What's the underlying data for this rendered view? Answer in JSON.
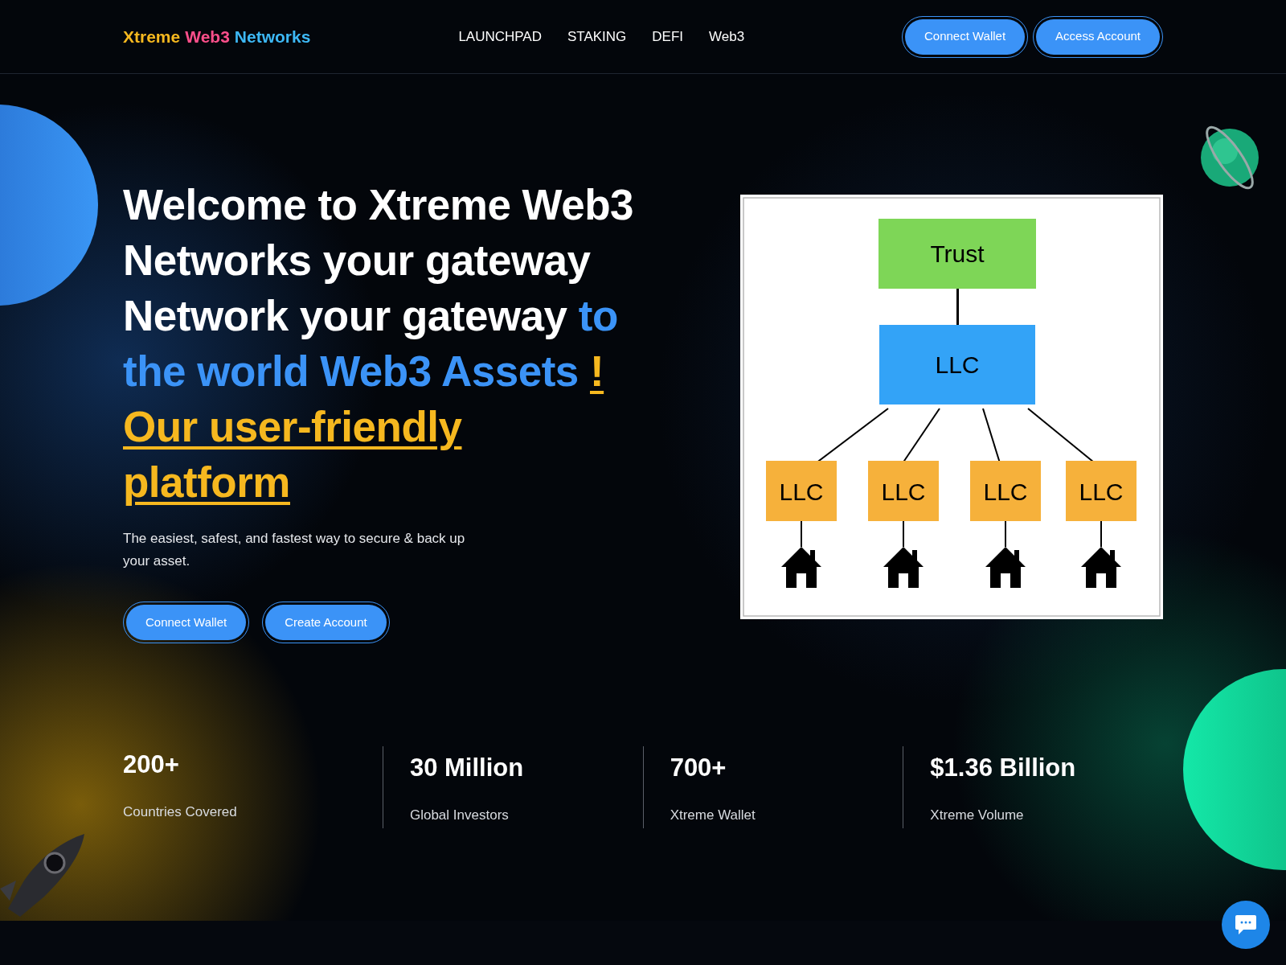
{
  "header": {
    "logo": [
      {
        "text": "Xtreme",
        "color": "#f6b81f"
      },
      {
        "text": "Web3",
        "color": "#ff4f8b"
      },
      {
        "text": "Networks",
        "color": "#3db8f5"
      }
    ],
    "nav": [
      "LAUNCHPAD",
      "STAKING",
      "DEFI",
      "Web3"
    ],
    "buttons": [
      "Connect Wallet",
      "Access Account"
    ]
  },
  "hero": {
    "heading": [
      {
        "text": "Welcome to Xtreme Web3 Networks your gateway Network your gateway ",
        "kind": "plain"
      },
      {
        "text": "to the world Web3 Assets ",
        "kind": "accent"
      },
      {
        "text": "! Our user-friendly platform",
        "kind": "underlined"
      }
    ],
    "subtitle": "The easiest, safest, and fastest way to secure & back up your asset.",
    "buttons": [
      "Connect Wallet",
      "Create Account"
    ],
    "diagram": {
      "root": {
        "label": "Trust",
        "color": "#7ed657"
      },
      "middle": {
        "label": "LLC",
        "color": "#33a3f7"
      },
      "children": [
        {
          "label": "LLC",
          "color": "#f6b13b"
        },
        {
          "label": "LLC",
          "color": "#f6b13b"
        },
        {
          "label": "LLC",
          "color": "#f6b13b"
        },
        {
          "label": "LLC",
          "color": "#f6b13b"
        }
      ]
    }
  },
  "stats": [
    {
      "value": "200+",
      "label": "Countries Covered"
    },
    {
      "value": "30 Million",
      "label": "Global Investors"
    },
    {
      "value": "700+",
      "label": "Xtreme Wallet"
    },
    {
      "value": "$1.36 Billion",
      "label": "Xtreme Volume"
    }
  ]
}
